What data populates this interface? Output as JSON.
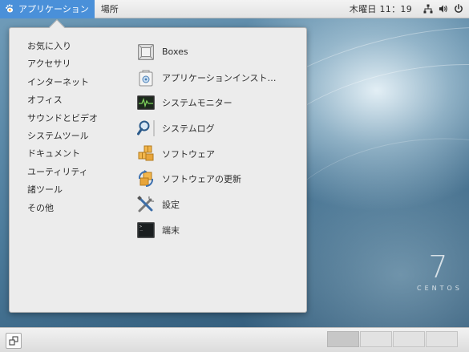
{
  "topbar": {
    "apps_label": "アプリケーション",
    "places_label": "場所",
    "clock": "木曜日 11：19",
    "tray_icons": [
      "network-icon",
      "volume-icon",
      "power-icon"
    ]
  },
  "menu": {
    "categories": [
      {
        "label": "お気に入り"
      },
      {
        "label": "アクセサリ"
      },
      {
        "label": "インターネット"
      },
      {
        "label": "オフィス"
      },
      {
        "label": "サウンドとビデオ"
      },
      {
        "label": "システムツール"
      },
      {
        "label": "ドキュメント"
      },
      {
        "label": "ユーティリティ"
      },
      {
        "label": "諸ツール"
      },
      {
        "label": "その他"
      }
    ],
    "apps": [
      {
        "label": "Boxes",
        "icon": "boxes-icon"
      },
      {
        "label": "アプリケーションインスト…",
        "icon": "app-installer-icon"
      },
      {
        "label": "システムモニター",
        "icon": "system-monitor-icon"
      },
      {
        "label": "システムログ",
        "icon": "system-log-icon"
      },
      {
        "label": "ソフトウェア",
        "icon": "software-icon"
      },
      {
        "label": "ソフトウェアの更新",
        "icon": "software-update-icon"
      },
      {
        "label": "設定",
        "icon": "settings-icon"
      },
      {
        "label": "端末",
        "icon": "terminal-icon"
      }
    ]
  },
  "desktop": {
    "logo_number": "7",
    "logo_text": "CENTOS"
  },
  "colors": {
    "accent": "#4a90d9",
    "menu_bg": "#ececec",
    "text": "#2e2e2e"
  },
  "bottombar": {
    "workspaces": 4,
    "active_workspace": 1
  }
}
